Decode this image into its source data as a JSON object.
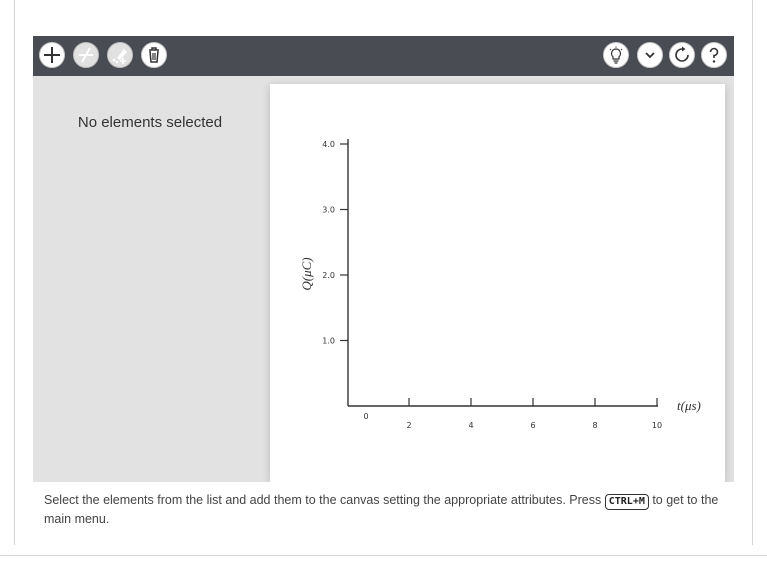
{
  "toolbar": {
    "left_buttons": [
      {
        "icon": "plus-icon",
        "label": "add"
      },
      {
        "icon": "tangent-icon",
        "label": "draw"
      },
      {
        "icon": "edit-points-icon",
        "label": "edit"
      },
      {
        "icon": "trash-icon",
        "label": "delete"
      }
    ],
    "right_buttons": [
      {
        "icon": "lightbulb-icon",
        "label": "hint"
      },
      {
        "icon": "chevron-down-icon",
        "label": "menu"
      },
      {
        "icon": "refresh-icon",
        "label": "reset"
      },
      {
        "icon": "question-icon",
        "label": "help"
      }
    ]
  },
  "sidebar": {
    "empty_text": "No elements selected"
  },
  "chart_data": {
    "type": "line",
    "series": [],
    "xlabel": "t(μs)",
    "ylabel": "Q(μC)",
    "x_ticks": [
      "0",
      "2",
      "4",
      "6",
      "8",
      "10"
    ],
    "y_ticks": [
      "1.0",
      "2.0",
      "3.0",
      "4.0"
    ],
    "xlim": [
      0,
      10
    ],
    "ylim": [
      0,
      4.0
    ],
    "grid": false
  },
  "footer": {
    "text_before": "Select the elements from the list and add them to the canvas setting the appropriate attributes. Press ",
    "shortcut": "CTRL+M",
    "text_after": " to get to the main menu."
  },
  "colors": {
    "toolbar_bg": "#4a4c53",
    "panel_bg": "#e2e2e2"
  }
}
